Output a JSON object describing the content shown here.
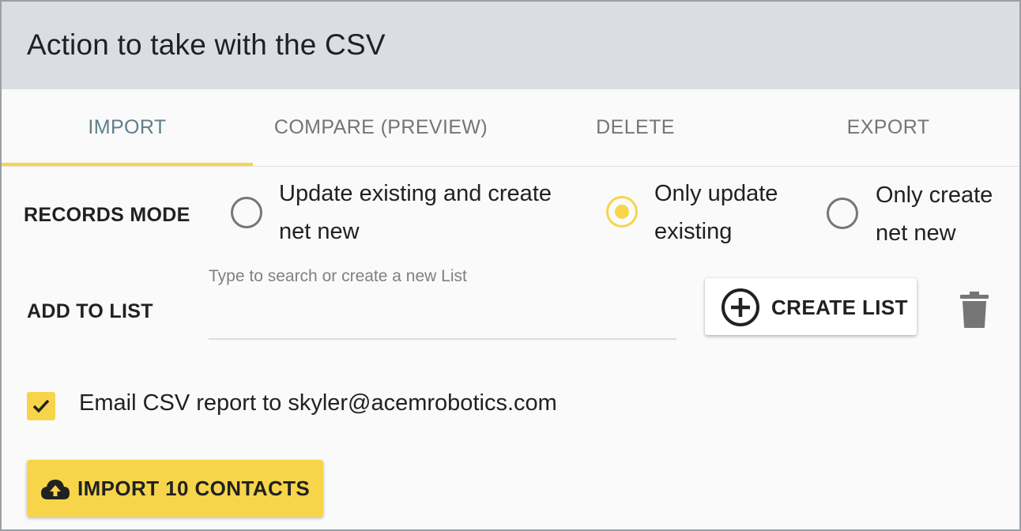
{
  "header": {
    "title": "Action to take with the CSV"
  },
  "tabs": [
    {
      "label": "IMPORT",
      "active": true
    },
    {
      "label": "COMPARE (PREVIEW)",
      "active": false
    },
    {
      "label": "DELETE",
      "active": false
    },
    {
      "label": "EXPORT",
      "active": false
    }
  ],
  "records_mode": {
    "label": "RECORDS MODE",
    "options": [
      {
        "line1": "Update existing and create",
        "line2": "net new",
        "selected": false
      },
      {
        "line1": "Only update",
        "line2": "existing",
        "selected": true
      },
      {
        "line1": "Only create",
        "line2": "net new",
        "selected": false
      }
    ]
  },
  "add_to_list": {
    "label": "ADD TO LIST",
    "input_label": "Type to search or create a new List",
    "input_value": "",
    "create_button_label": "CREATE LIST"
  },
  "email_report": {
    "checked": true,
    "label": "Email CSV report to skyler@acemrobotics.com"
  },
  "import_button": {
    "label": "IMPORT 10 CONTACTS"
  },
  "icons": {
    "create": "plus-circle-icon",
    "delete": "trash-icon",
    "check": "check-icon",
    "upload": "cloud-upload-icon"
  },
  "colors": {
    "accent": "#f7d54a",
    "header_bg": "#dadee2",
    "active_tab": "#5f7d8c",
    "inactive_tab": "#757575"
  }
}
